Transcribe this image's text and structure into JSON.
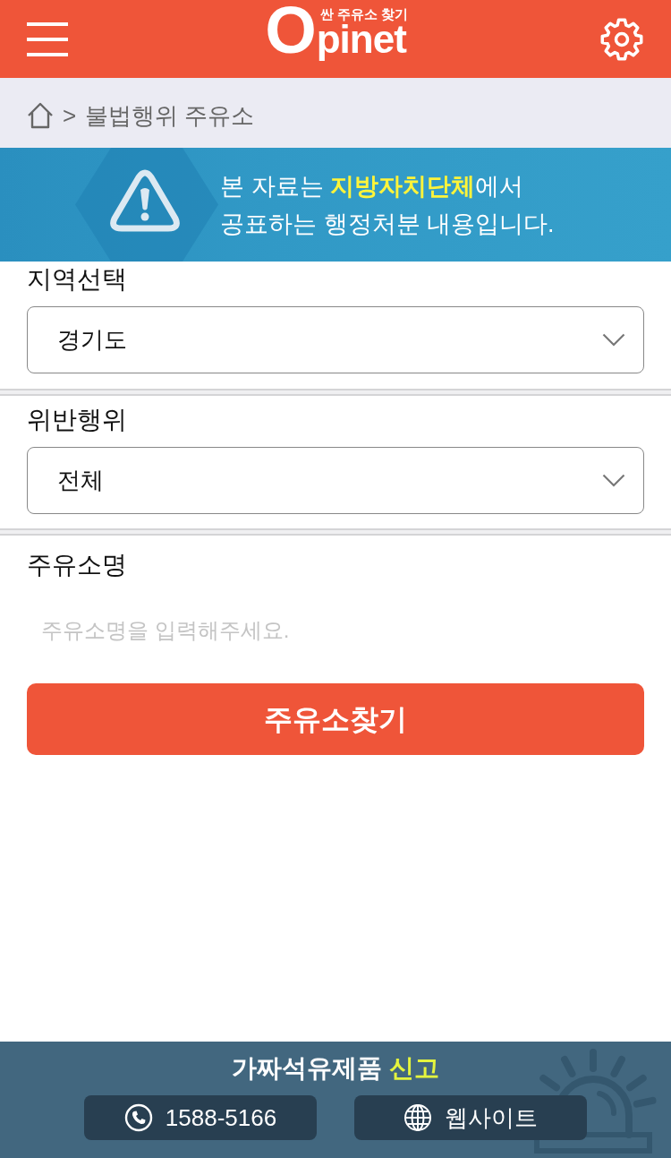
{
  "header": {
    "logo": "Opinet",
    "tagline": "싼 주유소 찾기"
  },
  "breadcrumb": {
    "separator": ">",
    "current": "불법행위 주유소"
  },
  "notice": {
    "lines": [
      "본 자료는 **지방자치단체**에서",
      "공표하는 행정처분 내용입니다."
    ]
  },
  "form": {
    "fields": [
      {
        "kind": "select",
        "label": "지역선택",
        "value": "경기도"
      },
      {
        "kind": "select",
        "label": "위반행위",
        "value": "전체"
      },
      {
        "kind": "text",
        "label": "주유소명",
        "placeholder": "주유소명을 입력해주세요."
      }
    ],
    "submit": "주유소찾기"
  },
  "footer": {
    "title": "가짜석유제품 **신고**",
    "buttons": [
      {
        "kind": "phone",
        "label": "1588-5166"
      },
      {
        "kind": "website",
        "label": "웹사이트"
      }
    ]
  }
}
